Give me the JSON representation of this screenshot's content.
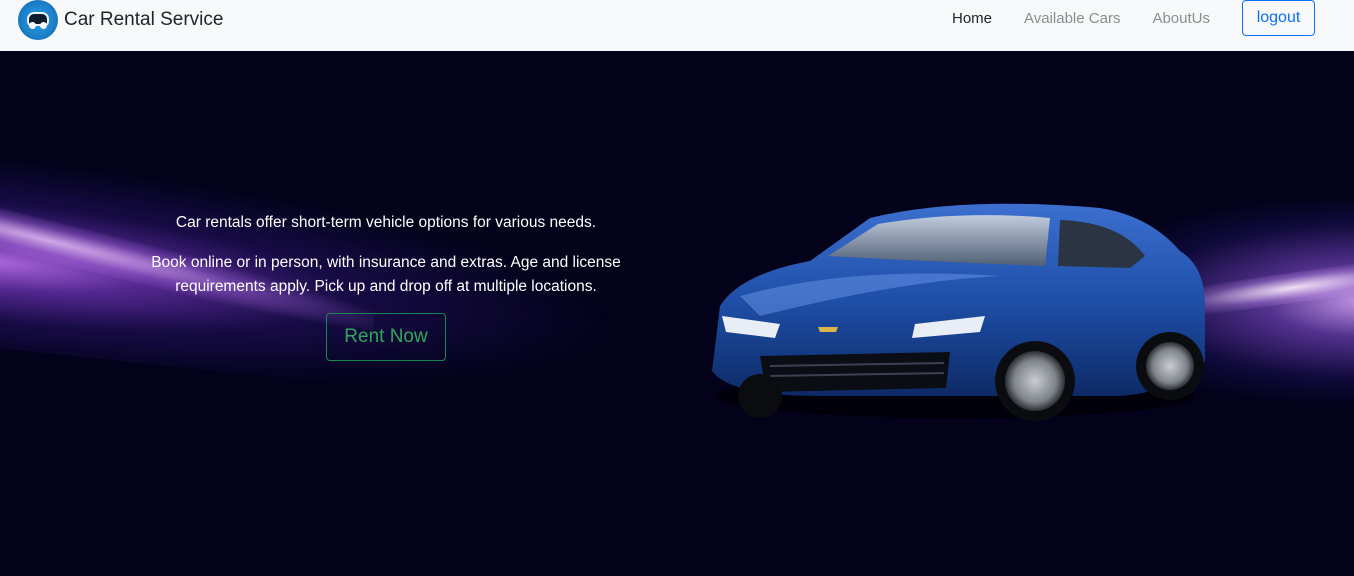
{
  "brand": {
    "name": "Car Rental Service",
    "logo_icon": "car-logo-icon"
  },
  "nav": {
    "items": [
      {
        "label": "Home",
        "active": true
      },
      {
        "label": "Available Cars",
        "active": false
      },
      {
        "label": "AboutUs",
        "active": false
      }
    ],
    "logout_label": "logout"
  },
  "hero": {
    "paragraph_1": "Car rentals offer short-term vehicle options for various needs.",
    "paragraph_2": "Book online or in person, with insurance and extras. Age and license requirements apply. Pick up and drop off at multiple locations.",
    "cta_label": "Rent Now",
    "image": "blue-sports-car-image"
  },
  "colors": {
    "navbar_bg": "#f8f9fa",
    "hero_bg": "#03021a",
    "primary": "#0d6efd",
    "success": "#198754",
    "car_blue": "#1e4fa8"
  }
}
